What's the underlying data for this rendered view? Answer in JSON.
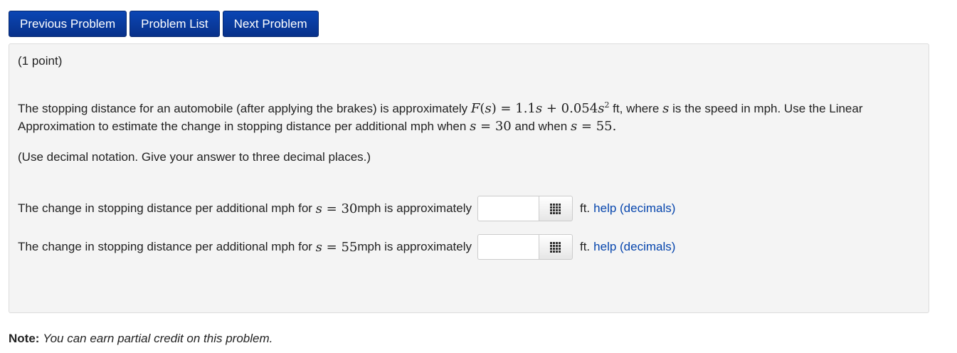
{
  "nav": {
    "previous_label": "Previous Problem",
    "list_label": "Problem List",
    "next_label": "Next Problem"
  },
  "problem": {
    "points": "(1 point)",
    "text_part1": "The stopping distance for an automobile (after applying the brakes) is approximately ",
    "formula_lhs": "F",
    "formula_var": "s",
    "formula_rhs": "1.1",
    "formula_mid": "0.054",
    "formula_exp": "2",
    "text_part2": " ft, where ",
    "text_part3": " is the speed in mph. Use the Linear Approximation to estimate the change in stopping distance per additional mph when ",
    "value_a": "30",
    "text_and": " and when ",
    "value_b": "55",
    "instructions": "(Use decimal notation. Give your answer to three decimal places.)"
  },
  "answers": [
    {
      "prefix": "The change in stopping distance per additional mph for ",
      "var": "s",
      "value": "30",
      "suffix": " mph is approximately",
      "input_value": "",
      "units": "ft.",
      "help": "help (decimals)"
    },
    {
      "prefix": "The change in stopping distance per additional mph for ",
      "var": "s",
      "value": "55",
      "suffix": " mph is approximately",
      "input_value": "",
      "units": "ft.",
      "help": "help (decimals)"
    }
  ],
  "note": {
    "label": "Note:",
    "text": "You can earn partial credit on this problem."
  },
  "colors": {
    "nav_button": "#0a3d9c",
    "panel_bg": "#f4f4f4",
    "link": "#0645ad"
  }
}
